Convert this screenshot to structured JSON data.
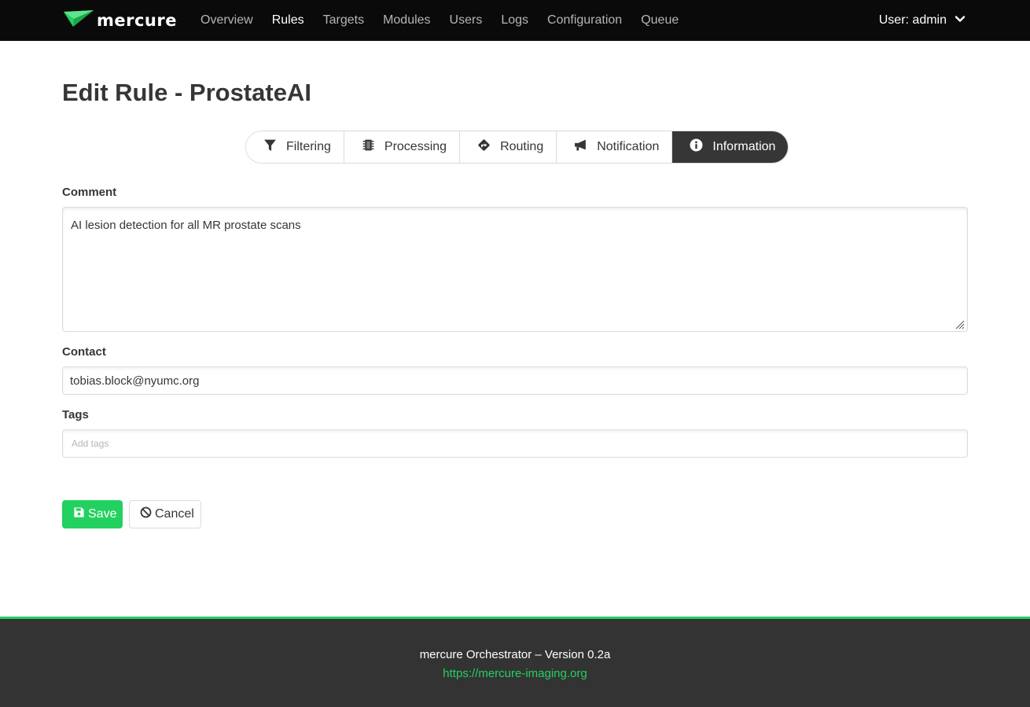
{
  "brand": {
    "name": "mercure",
    "logo_icon": "paper-plane-icon",
    "accent": "#23d160"
  },
  "nav": {
    "items": [
      {
        "label": "Overview"
      },
      {
        "label": "Rules",
        "active": true
      },
      {
        "label": "Targets"
      },
      {
        "label": "Modules"
      },
      {
        "label": "Users"
      },
      {
        "label": "Logs"
      },
      {
        "label": "Configuration"
      },
      {
        "label": "Queue"
      }
    ],
    "user_label": "User: admin"
  },
  "page": {
    "title": "Edit Rule - ProstateAI"
  },
  "tabs": [
    {
      "label": "Filtering",
      "icon": "filter-icon"
    },
    {
      "label": "Processing",
      "icon": "chip-icon"
    },
    {
      "label": "Routing",
      "icon": "route-sign-icon"
    },
    {
      "label": "Notification",
      "icon": "megaphone-icon"
    },
    {
      "label": "Information",
      "icon": "info-circle-icon",
      "active": true
    }
  ],
  "form": {
    "comment_label": "Comment",
    "comment_value": "AI lesion detection for all MR prostate scans",
    "contact_label": "Contact",
    "contact_value": "tobias.block@nyumc.org",
    "tags_label": "Tags",
    "tags_placeholder": "Add tags"
  },
  "actions": {
    "save_label": "Save",
    "cancel_label": "Cancel"
  },
  "footer": {
    "version_text": "mercure Orchestrator – Version 0.2a",
    "link_text": "https://mercure-imaging.org"
  }
}
